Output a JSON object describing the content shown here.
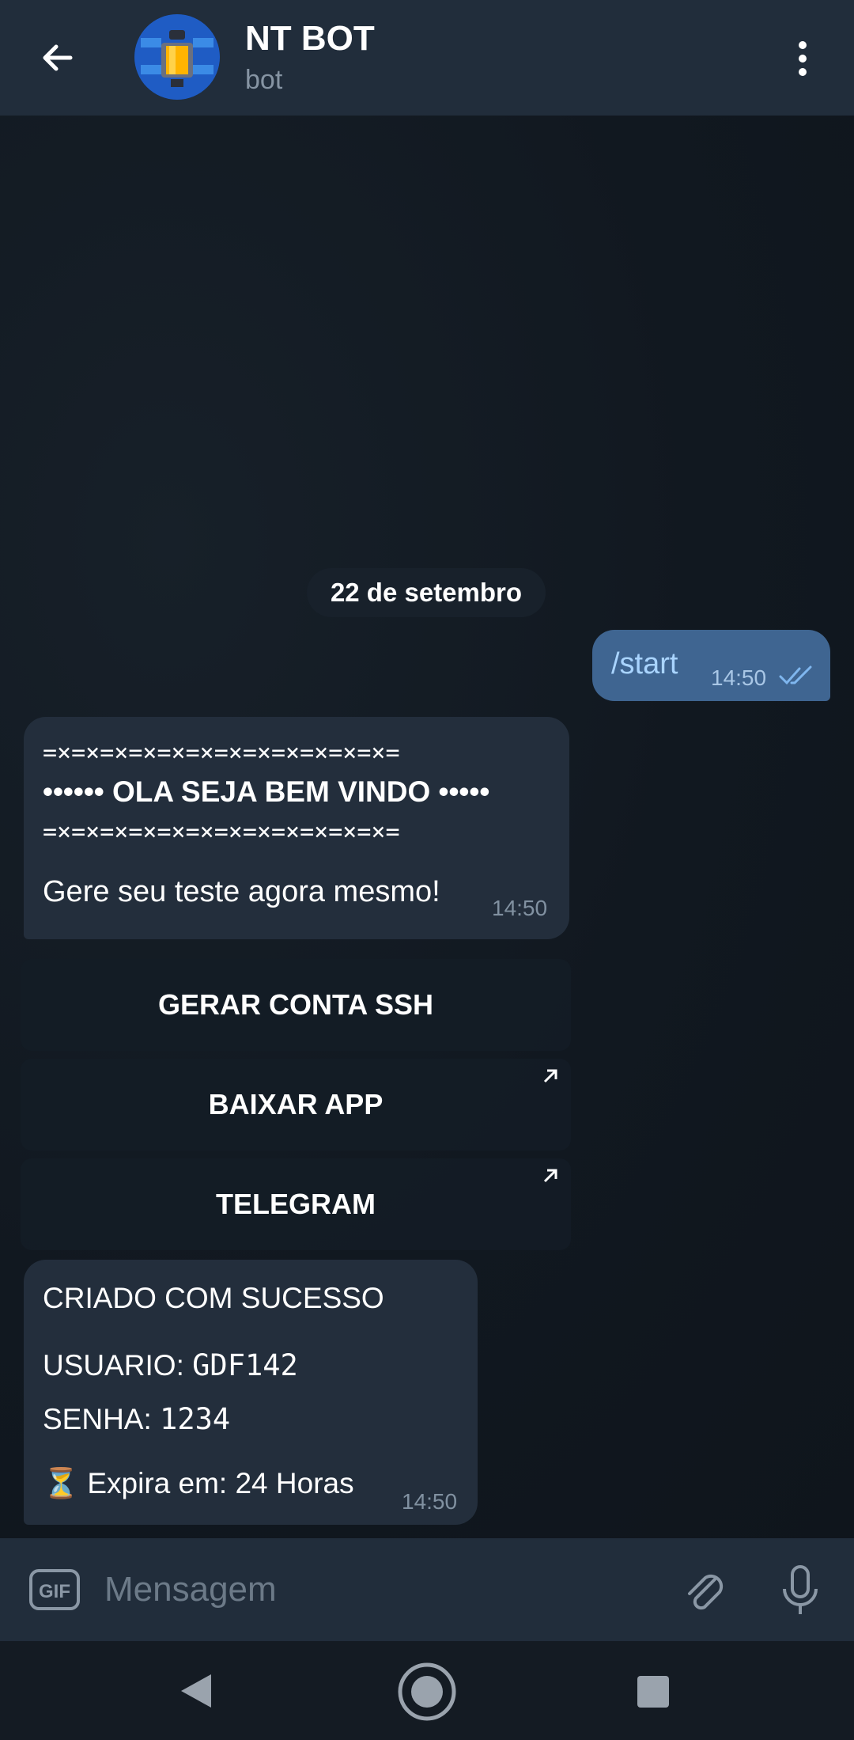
{
  "header": {
    "title": "NT BOT",
    "subtitle": "bot",
    "avatar_icon": "robot-bot-icon",
    "back_icon": "arrow-left-icon",
    "menu_icon": "more-vertical-icon"
  },
  "chat": {
    "date_label": "22 de setembro",
    "outgoing": {
      "text": "/start",
      "time": "14:50",
      "status_icon": "double-check-icon"
    },
    "welcome": {
      "line1": "=×=×=×=×=×=×=×=×=×=×=×=×=",
      "line2": "•••••• OLA SEJA BEM VINDO •••••",
      "line3": "=×=×=×=×=×=×=×=×=×=×=×=×=",
      "line4": "Gere seu teste agora mesmo!",
      "time": "14:50"
    },
    "keyboard": [
      {
        "label": "GERAR CONTA SSH",
        "external": false
      },
      {
        "label": "BAIXAR APP",
        "external": true
      },
      {
        "label": "TELEGRAM",
        "external": true
      }
    ],
    "result": {
      "title": "CRIADO COM SUCESSO",
      "user_label": "USUARIO: ",
      "user_value": "GDF142",
      "pass_label": "SENHA: ",
      "pass_value": "1234",
      "expire_emoji": "⏳",
      "expire_text": "Expira em: 24 Horas",
      "time": "14:50"
    }
  },
  "input": {
    "placeholder": "Mensagem",
    "gif_label": "GIF",
    "attach_icon": "paperclip-icon",
    "mic_icon": "microphone-icon"
  },
  "colors": {
    "header_bg": "#212d3b",
    "outgoing_bubble": "#3f6591",
    "incoming_bubble": "#232e3c",
    "chat_bg": "#0f151c"
  }
}
